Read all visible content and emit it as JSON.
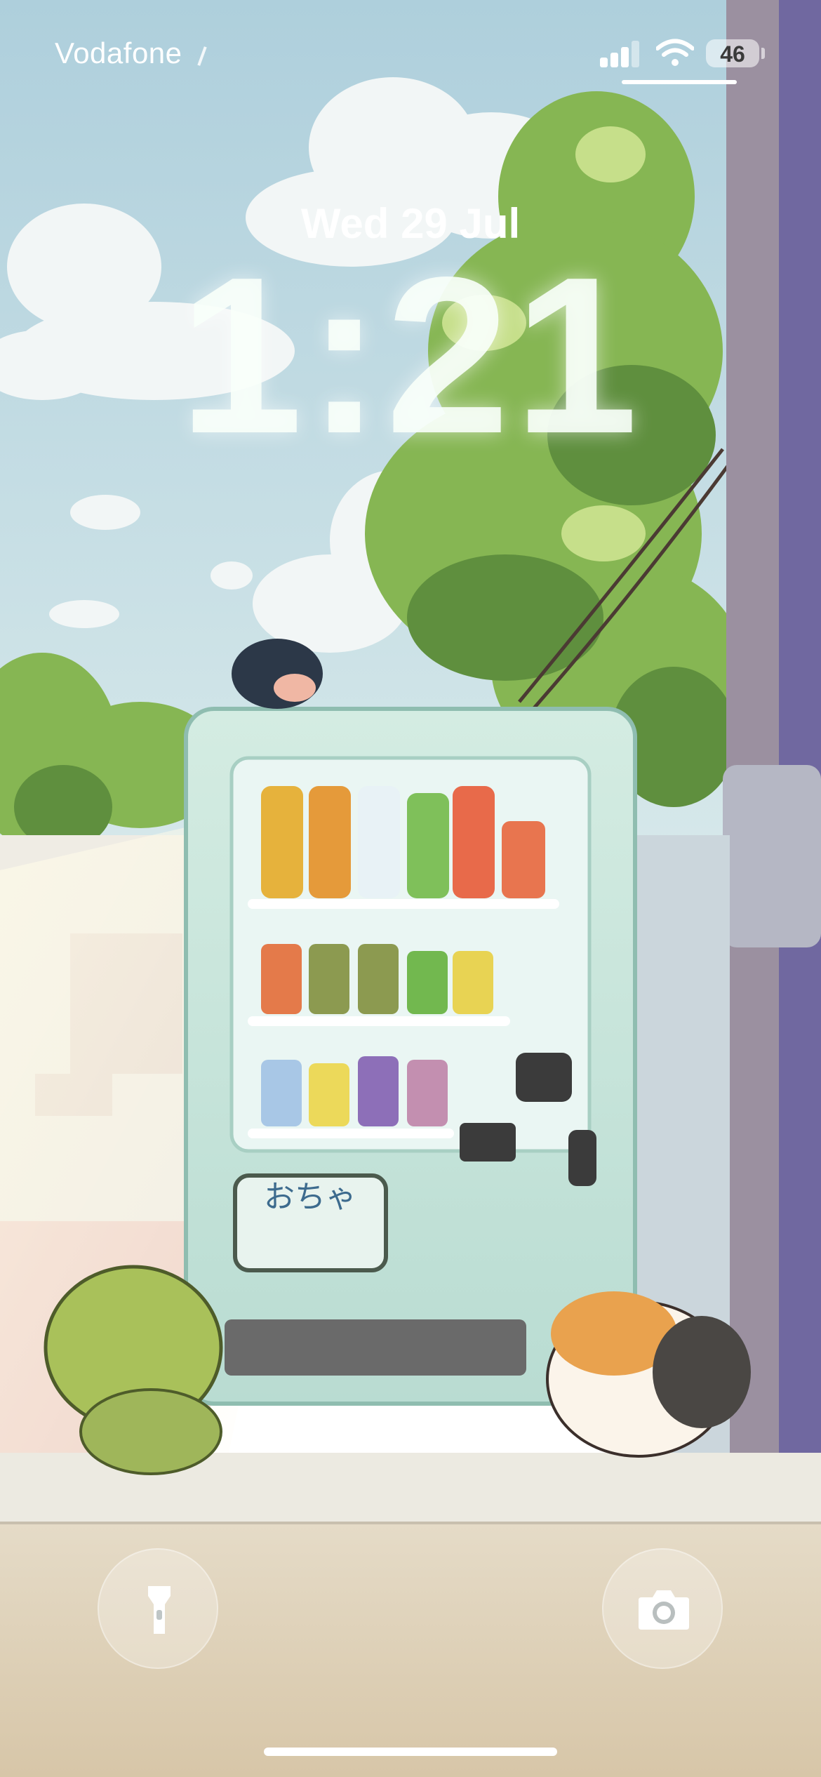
{
  "status_bar": {
    "carrier": "Vodafone",
    "battery": "46"
  },
  "lock_screen": {
    "date": "Wed 29 Jul",
    "time": "1:21"
  },
  "wallpaper": {
    "vending_machine_label": "おちゃ"
  },
  "quick_actions": {
    "left": "flashlight-icon",
    "right": "camera-icon"
  },
  "colors": {
    "sky": "#b9d6dc",
    "foliage": "#84b24e",
    "machine": "#c9e4d8",
    "sidewalk": "#d8cdb9"
  }
}
